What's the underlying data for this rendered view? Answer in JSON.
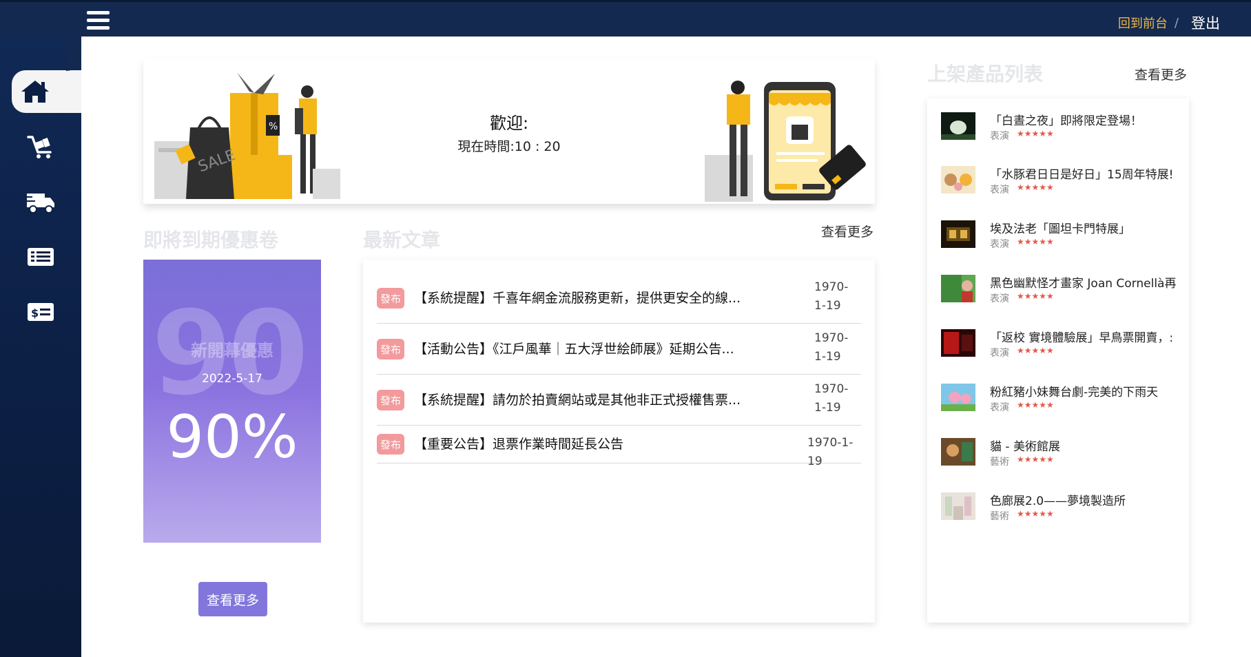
{
  "header": {
    "back_to_front": "回到前台",
    "separator": "/",
    "logout": "登出"
  },
  "sidebar": {
    "items": [
      {
        "icon": "home-icon",
        "active": true
      },
      {
        "icon": "cart-icon",
        "active": false
      },
      {
        "icon": "truck-icon",
        "active": false
      },
      {
        "icon": "list-icon",
        "active": false
      },
      {
        "icon": "coupon-icon",
        "active": false
      }
    ]
  },
  "welcome": {
    "title": "歡迎:",
    "time": "現在時間:10 : 20"
  },
  "coupons": {
    "section_title": "即將到期優惠卷",
    "big_number": "90",
    "name": "新開幕優惠",
    "date": "2022-5-17",
    "percent": "90%",
    "more": "查看更多"
  },
  "articles": {
    "section_title": "最新文章",
    "more": "查看更多",
    "items": [
      {
        "badge": "發布",
        "title": "【系統提醒】千喜年網金流服務更新，提供更安全的線...",
        "date": "1970-1-19"
      },
      {
        "badge": "發布",
        "title": "【活動公告】《江戶風華｜五大浮世絵師展》延期公告...",
        "date": "1970-1-19"
      },
      {
        "badge": "發布",
        "title": "【系統提醒】請勿於拍賣網站或是其他非正式授權售票...",
        "date": "1970-1-19"
      },
      {
        "badge": "發布",
        "title": "【重要公告】退票作業時間延長公告",
        "date": "1970-1-19"
      }
    ]
  },
  "products": {
    "section_title": "上架產品列表",
    "more": "查看更多",
    "items": [
      {
        "title": "「白晝之夜」即將限定登場！",
        "category": "表演",
        "stars": "★★★★★"
      },
      {
        "title": "「水豚君日日是好日」15周年特展!",
        "category": "表演",
        "stars": "★★★★★"
      },
      {
        "title": "埃及法老「圖坦卡門特展」",
        "category": "表演",
        "stars": "★★★★★"
      },
      {
        "title": "黑色幽默怪才畫家 Joan Cornellà再",
        "category": "表演",
        "stars": "★★★★★"
      },
      {
        "title": "「返校 實境體驗展」早鳥票開賣，:",
        "category": "表演",
        "stars": "★★★★★"
      },
      {
        "title": "粉紅豬小妹舞台劇-完美的下雨天",
        "category": "表演",
        "stars": "★★★★★"
      },
      {
        "title": "貓 - 美術館展",
        "category": "藝術",
        "stars": "★★★★★"
      },
      {
        "title": "色廊展2.0——夢境製造所",
        "category": "藝術",
        "stars": "★★★★★"
      }
    ]
  }
}
